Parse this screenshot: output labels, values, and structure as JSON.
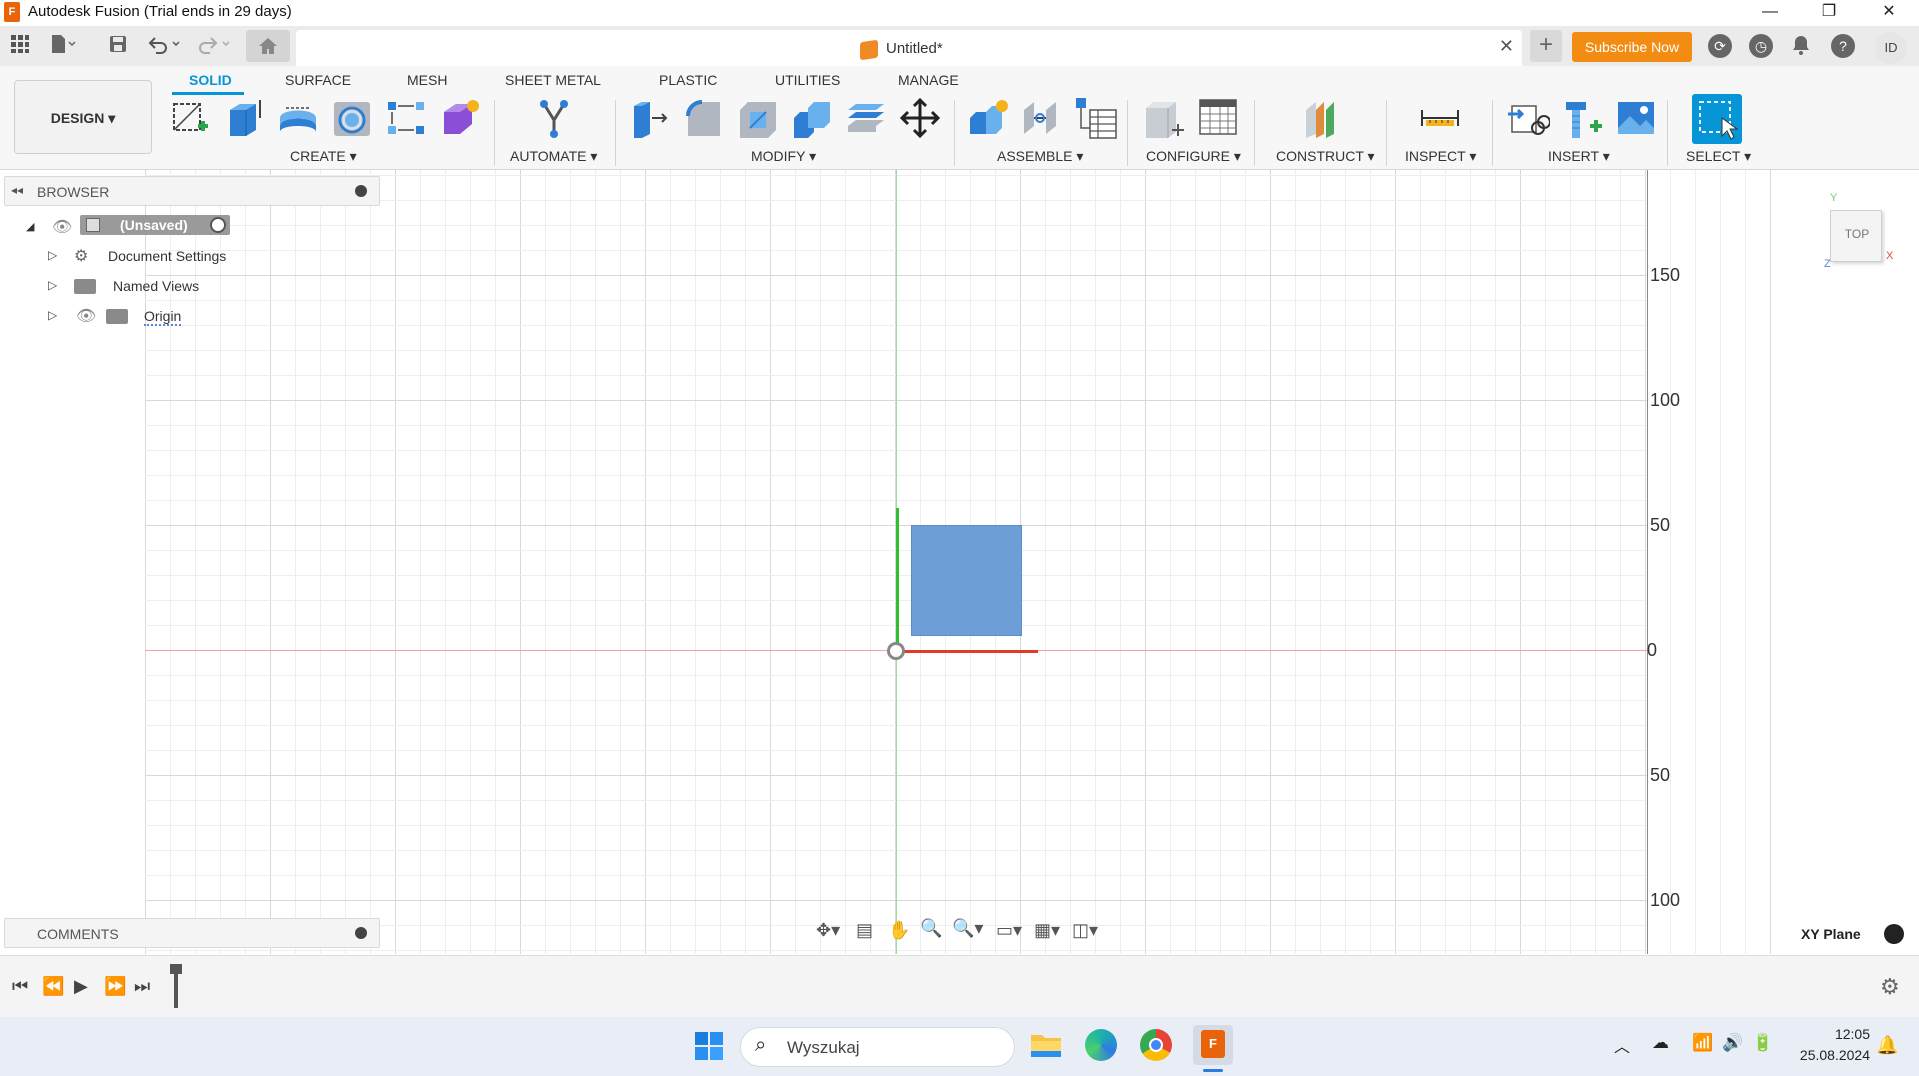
{
  "window": {
    "title": "Autodesk Fusion (Trial ends in 29 days)",
    "app_icon": "F",
    "controls": [
      "—",
      "❐",
      "✕"
    ]
  },
  "tabbar": {
    "document_name": "Untitled*",
    "subscribe_label": "Subscribe Now",
    "avatar_initials": "ID"
  },
  "toolbar": {
    "workspace_label": "DESIGN ▾",
    "tabs": [
      "SOLID",
      "SURFACE",
      "MESH",
      "SHEET METAL",
      "PLASTIC",
      "UTILITIES",
      "MANAGE"
    ],
    "active_tab": "SOLID",
    "groups": [
      "CREATE ▾",
      "AUTOMATE ▾",
      "MODIFY ▾",
      "ASSEMBLE ▾",
      "CONFIGURE ▾",
      "CONSTRUCT ▾",
      "INSPECT ▾",
      "INSERT ▾",
      "SELECT ▾"
    ],
    "accent_color": "#0696d7"
  },
  "browser": {
    "title": "BROWSER",
    "items": [
      {
        "label": "(Unsaved)"
      },
      {
        "label": "Document Settings"
      },
      {
        "label": "Named Views"
      },
      {
        "label": "Origin"
      }
    ]
  },
  "comments": {
    "title": "COMMENTS"
  },
  "viewport": {
    "ruler_labels": [
      "150",
      "100",
      "50",
      "0",
      "50",
      "100"
    ],
    "viewcube_label": "TOP",
    "axes": {
      "x": "X",
      "y": "Y",
      "z": "Z"
    },
    "plane_label": "XY Plane",
    "sketch_fill": "#6d9fd6"
  },
  "taskbar": {
    "search_placeholder": "Wyszukaj",
    "time": "12:05",
    "date": "25.08.2024"
  }
}
